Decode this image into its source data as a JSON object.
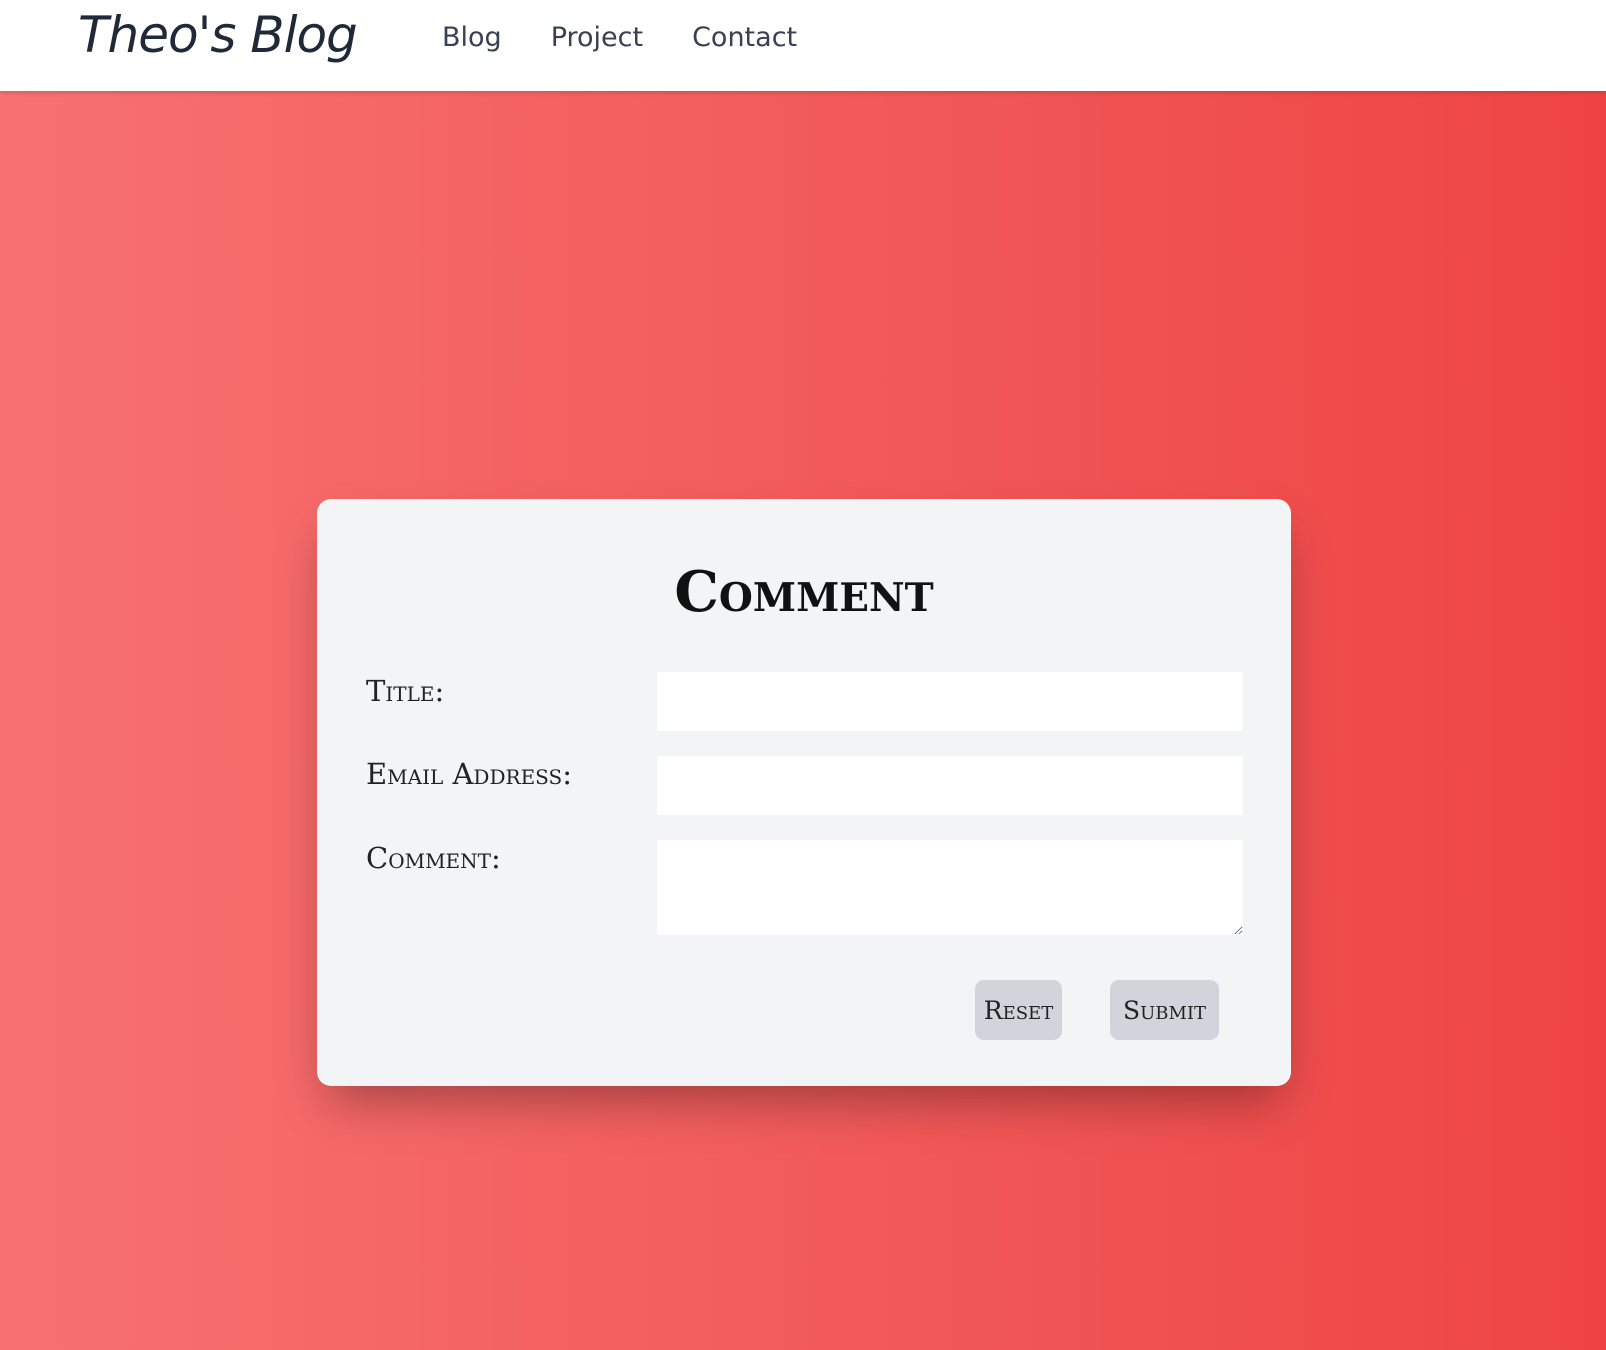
{
  "header": {
    "brand": "Theo's Blog",
    "nav": [
      {
        "label": "Blog"
      },
      {
        "label": "Project"
      },
      {
        "label": "Contact"
      }
    ]
  },
  "form": {
    "title": "Comment",
    "fields": {
      "title": {
        "label": "Title:",
        "value": ""
      },
      "email": {
        "label": "Email Address:",
        "value": ""
      },
      "comment": {
        "label": "Comment:",
        "value": ""
      }
    },
    "reset_label": "Reset",
    "submit_label": "Submit"
  },
  "colors": {
    "background_gradient_start": "#f87171",
    "background_gradient_end": "#ef4444",
    "card": "#f3f4f6",
    "button": "#d1d5db"
  }
}
